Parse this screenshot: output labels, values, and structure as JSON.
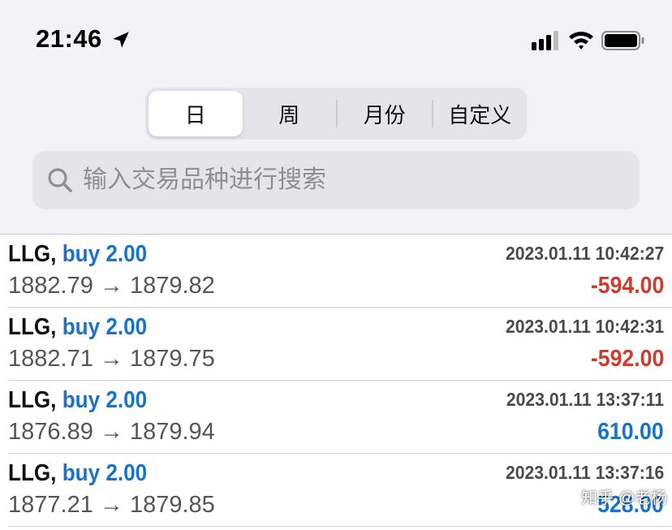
{
  "status_bar": {
    "time": "21:46",
    "icons": [
      "location-arrow-icon",
      "cellular-signal-icon",
      "wifi-icon",
      "battery-icon"
    ]
  },
  "period_tabs": {
    "items": [
      {
        "label": "日",
        "active": true
      },
      {
        "label": "周",
        "active": false
      },
      {
        "label": "月份",
        "active": false
      },
      {
        "label": "自定义",
        "active": false
      }
    ]
  },
  "search": {
    "placeholder": "输入交易品种进行搜索",
    "value": ""
  },
  "colors": {
    "accent_blue": "#1a73c9",
    "loss_red": "#cf3b2f",
    "background": "#f2f2f7"
  },
  "deals": [
    {
      "symbol": "LLG,",
      "side": "buy 2.00",
      "time": "2023.01.11 10:42:27",
      "prices": "1882.79 → 1879.82",
      "profit": "-594.00",
      "profit_sign": "negative"
    },
    {
      "symbol": "LLG,",
      "side": "buy 2.00",
      "time": "2023.01.11 10:42:31",
      "prices": "1882.71 → 1879.75",
      "profit": "-592.00",
      "profit_sign": "negative"
    },
    {
      "symbol": "LLG,",
      "side": "buy 2.00",
      "time": "2023.01.11 13:37:11",
      "prices": "1876.89 → 1879.94",
      "profit": "610.00",
      "profit_sign": "positive"
    },
    {
      "symbol": "LLG,",
      "side": "buy 2.00",
      "time": "2023.01.11 13:37:16",
      "prices": "1877.21 → 1879.85",
      "profit": "528.00",
      "profit_sign": "positive"
    }
  ],
  "watermark": {
    "text": "知乎 @老杨"
  }
}
